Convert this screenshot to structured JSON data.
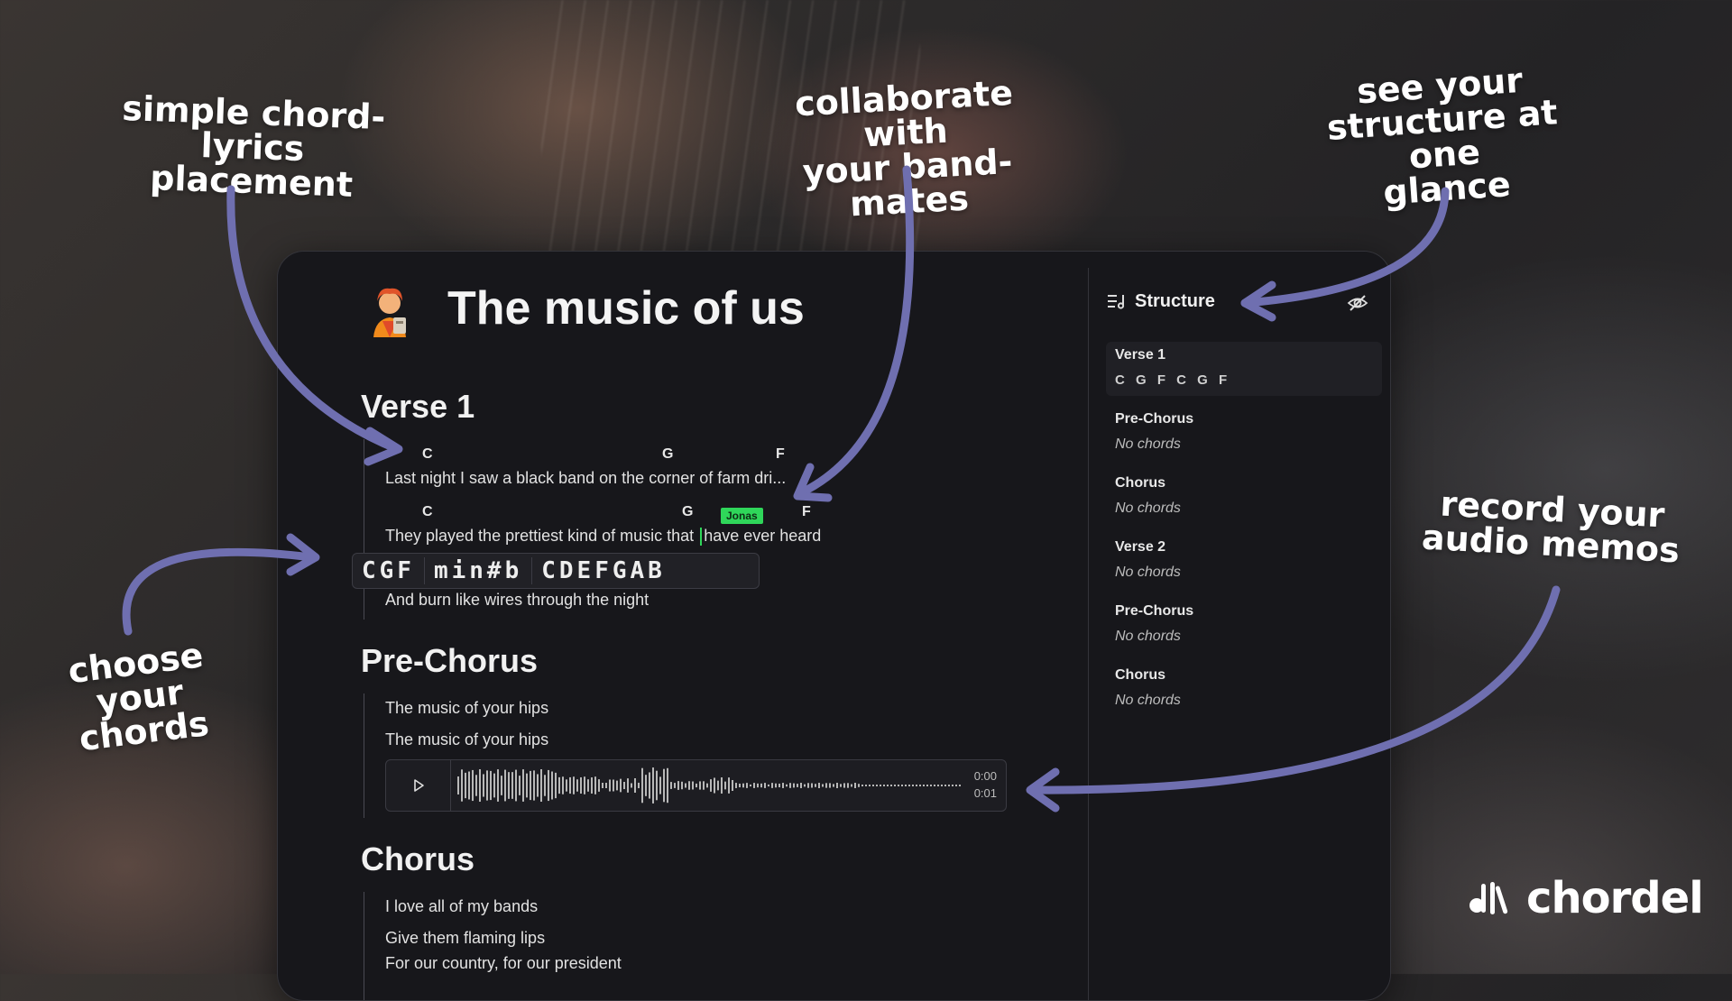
{
  "annotations": {
    "chord_lyrics": [
      "simple chord-",
      "lyrics placement"
    ],
    "collaborate": [
      "collaborate with",
      "your band-mates"
    ],
    "structure": [
      "see your",
      "structure at one",
      "glance"
    ],
    "choose_chords": [
      "choose your",
      "chords"
    ],
    "audio_memos": [
      "record your",
      "audio memos"
    ]
  },
  "colors": {
    "arrow": "#6f6fb0",
    "collab_green": "#2fd65a",
    "panel_bg": "#17171b"
  },
  "document": {
    "icon": "singer-emoji-icon",
    "title": "The music of us"
  },
  "sections": [
    {
      "heading": "Verse 1",
      "lines": [
        {
          "chords": [
            "C",
            "G",
            "F"
          ],
          "lyric": "Last night I saw a black band on the corner of farm dri..."
        },
        {
          "chords": [
            "C",
            "G",
            "F"
          ],
          "lyric_before": "They played the prettiest kind of music that ",
          "lyric_after": "have ever heard"
        },
        {
          "lyric": "And burn like wires through the night"
        }
      ]
    },
    {
      "heading": "Pre-Chorus",
      "lines": [
        {
          "lyric": "The music of your hips"
        },
        {
          "lyric": "The music of your hips"
        }
      ]
    },
    {
      "heading": "Chorus",
      "lines": [
        {
          "lyric": "I love all of my bands"
        },
        {
          "lyric": "Give them flaming lips"
        },
        {
          "lyric": "For our country, for our president"
        }
      ]
    }
  ],
  "collaborator": {
    "name": "Jonas"
  },
  "chord_picker": {
    "groups": [
      "CGF",
      "min#b",
      "CDEFGAB"
    ]
  },
  "audio": {
    "current_time": "0:00",
    "duration": "0:01",
    "play_icon": "play-icon"
  },
  "structure": {
    "title": "Structure",
    "icon": "structure-list-icon",
    "hide_icon": "eye-off-icon",
    "items": [
      {
        "name": "Verse 1",
        "sub": "C G F C G F",
        "has_chords": true,
        "active": true
      },
      {
        "name": "Pre-Chorus",
        "sub": "No chords",
        "has_chords": false
      },
      {
        "name": "Chorus",
        "sub": "No chords",
        "has_chords": false
      },
      {
        "name": "Verse 2",
        "sub": "No chords",
        "has_chords": false
      },
      {
        "name": "Pre-Chorus",
        "sub": "No chords",
        "has_chords": false
      },
      {
        "name": "Chorus",
        "sub": "No chords",
        "has_chords": false
      }
    ]
  },
  "brand": {
    "name": "chordel",
    "icon": "chordel-logo-icon"
  }
}
